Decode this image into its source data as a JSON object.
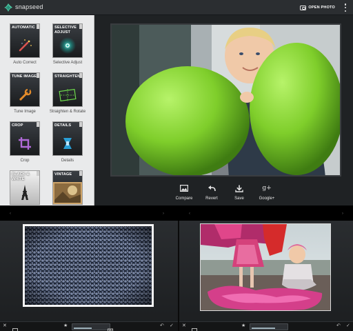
{
  "app": {
    "title": "snapseed",
    "open_photo_label": "OPEN PHOTO"
  },
  "tools": [
    {
      "name": "AUTOMATIC",
      "caption": "Auto Correct",
      "icon": "magic-wand-icon"
    },
    {
      "name": "SELECTIVE ADJUST",
      "caption": "Selective Adjust",
      "icon": "control-point-icon"
    },
    {
      "name": "TUNE IMAGE",
      "caption": "Tune Image",
      "icon": "wrench-icon"
    },
    {
      "name": "STRAIGHTEN",
      "caption": "Straighten & Rotate",
      "icon": "straighten-icon"
    },
    {
      "name": "CROP",
      "caption": "Crop",
      "icon": "crop-icon"
    },
    {
      "name": "DETAILS",
      "caption": "Details",
      "icon": "details-icon"
    },
    {
      "name": "BLACK & WHITE",
      "caption": "",
      "icon": "tower-icon"
    },
    {
      "name": "VINTAGE",
      "caption": "",
      "icon": "vintage-photo-icon"
    }
  ],
  "actions": {
    "compare": "Compare",
    "revert": "Revert",
    "save": "Save",
    "google_plus": "Google+",
    "google_plus_icon_text": "g+"
  },
  "colors": {
    "balloon_green": "#7fce2b",
    "app_background": "#1f2224",
    "tools_panel": "#e9eaeb"
  }
}
